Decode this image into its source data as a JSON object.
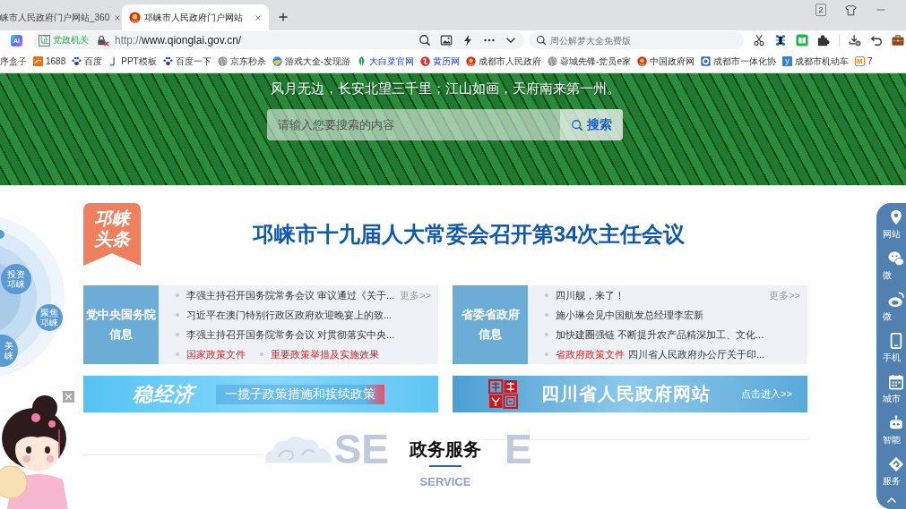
{
  "browser": {
    "tabs": [
      {
        "title": "崃市人民政府门户网站_360",
        "favicon": false,
        "selected": false
      },
      {
        "title": "邛崃市人民政府门户网站",
        "favicon": true,
        "selected": true
      }
    ],
    "tab_count": "2",
    "toolbar": {
      "assistant": "AI",
      "certificate_glyph": "证",
      "site_category": "党政机关",
      "secure": false,
      "url_scheme": "http://",
      "url_rest": "www.qionglai.gov.cn/",
      "search_placeholder": "周公解梦大全免费版"
    },
    "bookmarks": [
      {
        "label": "序盒子",
        "kind": "none",
        "highlighted": false
      },
      {
        "label": "1688",
        "kind": "ali",
        "highlighted": false
      },
      {
        "label": "百度",
        "kind": "paw",
        "highlighted": false
      },
      {
        "label": "PPT模板",
        "kind": "hook",
        "highlighted": false
      },
      {
        "label": "百度一下",
        "kind": "paw",
        "highlighted": false
      },
      {
        "label": "京东秒杀",
        "kind": "globe",
        "highlighted": false
      },
      {
        "label": "游戏大全-发现游",
        "kind": "ball",
        "highlighted": false
      },
      {
        "label": "大白菜官网",
        "kind": "leaf",
        "highlighted": true
      },
      {
        "label": "黄历网",
        "kind": "swirl",
        "highlighted": true
      },
      {
        "label": "成都市人民政府",
        "kind": "emblem",
        "highlighted": false
      },
      {
        "label": "蓉城先锋-党员e家",
        "kind": "globe",
        "highlighted": false
      },
      {
        "label": "中国政府网",
        "kind": "emblem",
        "highlighted": false
      },
      {
        "label": "成都市一体化协",
        "kind": "ring",
        "highlighted": false
      },
      {
        "label": "成都市机动车",
        "kind": "tile",
        "glyph": "y",
        "highlighted": false
      },
      {
        "label": "7",
        "kind": "frame",
        "glyph": "M",
        "highlighted": false
      }
    ]
  },
  "page": {
    "banner": {
      "slogan": "风月无边，长安北望三千里；江山如画，天府南来第一州。",
      "search": {
        "placeholder": "请输入您要搜索的内容",
        "button": "搜索"
      }
    },
    "circle_menu": [
      {
        "lines": [
          "投资",
          "邛崃"
        ]
      },
      {
        "lines": [
          "聚焦",
          "邛崃"
        ]
      },
      {
        "lines": [
          "美",
          "崃"
        ]
      }
    ],
    "headline": {
      "badge_lines": [
        "邛崃",
        "头条"
      ],
      "title": "邛崃市十九届人大常委会召开第34次主任会议"
    },
    "news_panels": [
      {
        "label_lines": [
          "党中央国务院",
          "信息"
        ],
        "more": "更多>>",
        "rows": [
          {
            "entries": [
              {
                "kind": "news",
                "text": "李强主持召开国务院常务会议 审议通过《关于..."
              }
            ]
          },
          {
            "entries": [
              {
                "kind": "news",
                "text": "习近平在澳门特别行政区政府欢迎晚宴上的致..."
              }
            ]
          },
          {
            "entries": [
              {
                "kind": "news",
                "text": "李强主持召开国务院常务会议 对贯彻落实中央..."
              }
            ]
          },
          {
            "entries": [
              {
                "kind": "category",
                "text": "国家政策文件"
              },
              {
                "kind": "category",
                "text": "重要政策举措及实施效果"
              }
            ]
          }
        ]
      },
      {
        "label_lines": [
          "省委省政府",
          "信息"
        ],
        "more": "更多>>",
        "rows": [
          {
            "entries": [
              {
                "kind": "news",
                "text": "四川舰，来了！"
              }
            ]
          },
          {
            "entries": [
              {
                "kind": "news",
                "text": "施小琳会见中国航发总经理李宏新"
              }
            ]
          },
          {
            "entries": [
              {
                "kind": "news",
                "text": "加快建圈强链 不断提升农产品精深加工、文化..."
              }
            ]
          },
          {
            "entries": [
              {
                "kind": "category",
                "text": "省政府政策文件",
                "detail": "四川省人民政府办公厅关于印..."
              }
            ]
          }
        ]
      }
    ],
    "promo_banners": [
      {
        "kind": "economy",
        "title": "稳经济",
        "subtitle": "一揽子政策措施和接续政策"
      },
      {
        "kind": "province",
        "title": "四川省人民政府网站",
        "action": "点击进入>>"
      }
    ],
    "service_section": {
      "backdrop_left": "SE",
      "title": "政务服务",
      "backdrop_right": "E",
      "subtitle": "SERVICE"
    }
  },
  "side_toolbar": [
    {
      "kind": "pin",
      "label": "网站"
    },
    {
      "kind": "chat",
      "label": "微"
    },
    {
      "kind": "oval",
      "label": "微"
    },
    {
      "kind": "phone",
      "label": "手机"
    },
    {
      "kind": "calendar",
      "label": "城市"
    },
    {
      "kind": "robot",
      "label": "智能"
    },
    {
      "kind": "diamond",
      "label": "服务"
    }
  ]
}
